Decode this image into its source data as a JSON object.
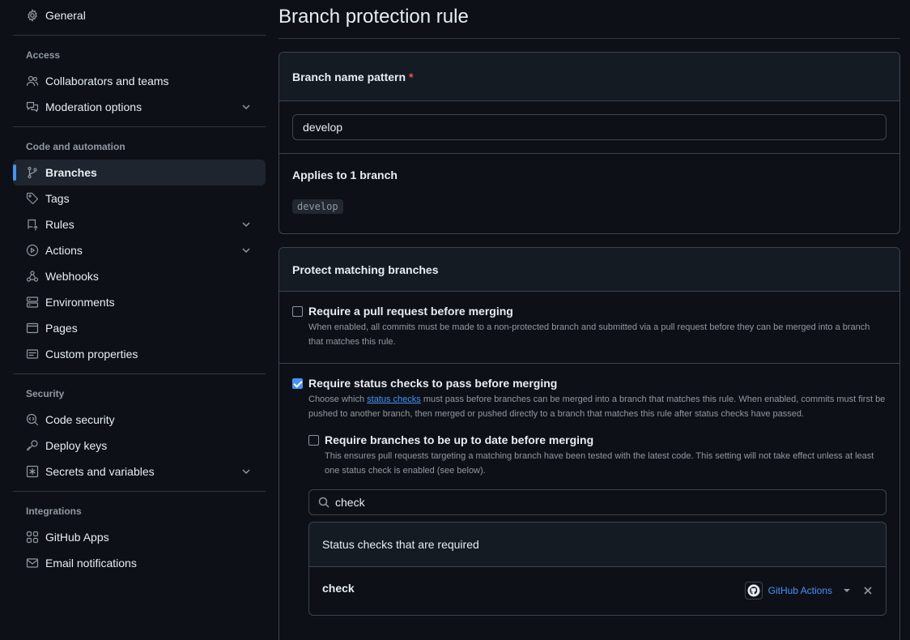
{
  "sidebar": {
    "general": "General",
    "groups": [
      {
        "title": "Access",
        "items": [
          {
            "label": "Collaborators and teams",
            "icon": "people-icon",
            "chevron": false,
            "active": false
          },
          {
            "label": "Moderation options",
            "icon": "comment-discussion-icon",
            "chevron": true,
            "active": false
          }
        ]
      },
      {
        "title": "Code and automation",
        "items": [
          {
            "label": "Branches",
            "icon": "git-branch-icon",
            "chevron": false,
            "active": true
          },
          {
            "label": "Tags",
            "icon": "tag-icon",
            "chevron": false,
            "active": false
          },
          {
            "label": "Rules",
            "icon": "repo-push-icon",
            "chevron": true,
            "active": false
          },
          {
            "label": "Actions",
            "icon": "play-icon",
            "chevron": true,
            "active": false
          },
          {
            "label": "Webhooks",
            "icon": "webhook-icon",
            "chevron": false,
            "active": false
          },
          {
            "label": "Environments",
            "icon": "server-icon",
            "chevron": false,
            "active": false
          },
          {
            "label": "Pages",
            "icon": "browser-icon",
            "chevron": false,
            "active": false
          },
          {
            "label": "Custom properties",
            "icon": "note-icon",
            "chevron": false,
            "active": false
          }
        ]
      },
      {
        "title": "Security",
        "items": [
          {
            "label": "Code security",
            "icon": "codescan-icon",
            "chevron": false,
            "active": false
          },
          {
            "label": "Deploy keys",
            "icon": "key-icon",
            "chevron": false,
            "active": false
          },
          {
            "label": "Secrets and variables",
            "icon": "key-asterisk-icon",
            "chevron": true,
            "active": false
          }
        ]
      },
      {
        "title": "Integrations",
        "items": [
          {
            "label": "GitHub Apps",
            "icon": "apps-icon",
            "chevron": false,
            "active": false
          },
          {
            "label": "Email notifications",
            "icon": "mail-icon",
            "chevron": false,
            "active": false
          }
        ]
      }
    ]
  },
  "main": {
    "title": "Branch protection rule",
    "pattern": {
      "label": "Branch name pattern",
      "required_mark": "*",
      "value": "develop",
      "applies_label": "Applies to 1 branch",
      "branch_chip": "develop"
    },
    "protect": {
      "heading": "Protect matching branches",
      "pr": {
        "title": "Require a pull request before merging",
        "desc": "When enabled, all commits must be made to a non-protected branch and submitted via a pull request before they can be merged into a branch that matches this rule.",
        "checked": false
      },
      "status": {
        "title": "Require status checks to pass before merging",
        "desc_before": "Choose which ",
        "desc_link": "status checks",
        "desc_after": " must pass before branches can be merged into a branch that matches this rule. When enabled, commits must first be pushed to another branch, then merged or pushed directly to a branch that matches this rule after status checks have passed.",
        "checked": true
      },
      "uptodate": {
        "title": "Require branches to be up to date before merging",
        "desc": "This ensures pull requests targeting a matching branch have been tested with the latest code. This setting will not take effect unless at least one status check is enabled (see below).",
        "checked": false
      },
      "search_value": "check",
      "required_heading": "Status checks that are required",
      "checks": [
        {
          "name": "check",
          "app": "GitHub Actions"
        }
      ]
    }
  },
  "colors": {
    "accent": "#4493f8",
    "background": "#0d1117",
    "border": "#3d444d",
    "required": "#f85149"
  }
}
